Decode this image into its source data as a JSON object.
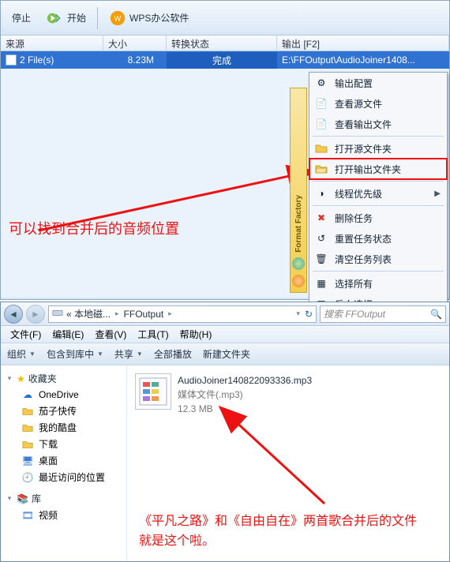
{
  "ff": {
    "toolbar": {
      "stop": "停止",
      "start": "开始",
      "wps": "WPS办公软件"
    },
    "headers": {
      "source": "来源",
      "size": "大小",
      "convert": "转换状态",
      "output": "输出 [F2]"
    },
    "row": {
      "source": "2 File(s)",
      "size": "8.23M",
      "convert": "完成",
      "output": "E:\\FFOutput\\AudioJoiner1408..."
    },
    "sidebar": "Format Factory",
    "ctx": {
      "out_cfg": "输出配置",
      "view_src": "查看源文件",
      "view_out": "查看输出文件",
      "open_src_folder": "打开源文件夹",
      "open_out_folder": "打开输出文件夹",
      "thread_priority": "线程优先级",
      "del_task": "删除任务",
      "reset_status": "重置任务状态",
      "clear_list": "清空任务列表",
      "select_all": "选择所有",
      "invert_sel": "反向选择"
    }
  },
  "annot1": "可以找到合并后的音频位置",
  "ex": {
    "crumb": {
      "disk": "« 本地磁...",
      "folder": "FFOutput"
    },
    "refresh_tri": "▾",
    "search_placeholder": "搜索 FFOutput",
    "menu": {
      "file": "文件(F)",
      "edit": "编辑(E)",
      "view": "查看(V)",
      "tools": "工具(T)",
      "help": "帮助(H)"
    },
    "tool": {
      "org": "组织",
      "include": "包含到库中",
      "share": "共享",
      "playall": "全部播放",
      "newfolder": "新建文件夹"
    },
    "nav": {
      "fav": "收藏夹",
      "items": [
        {
          "label": "OneDrive",
          "icon": "cloud"
        },
        {
          "label": "茄子快传",
          "icon": "folder"
        },
        {
          "label": "我的酷盘",
          "icon": "folder"
        },
        {
          "label": "下载",
          "icon": "folder"
        },
        {
          "label": "桌面",
          "icon": "desktop"
        },
        {
          "label": "最近访问的位置",
          "icon": "recent"
        }
      ],
      "lib": "库",
      "lib_items": [
        {
          "label": "视频",
          "icon": "video"
        }
      ]
    },
    "file": {
      "name": "AudioJoiner140822093336.mp3",
      "type": "媒体文件(.mp3)",
      "size": "12.3 MB"
    }
  },
  "annot2_l1": "《平凡之路》和《自由自在》两首歌合并后的文件",
  "annot2_l2": "就是这个啦。"
}
